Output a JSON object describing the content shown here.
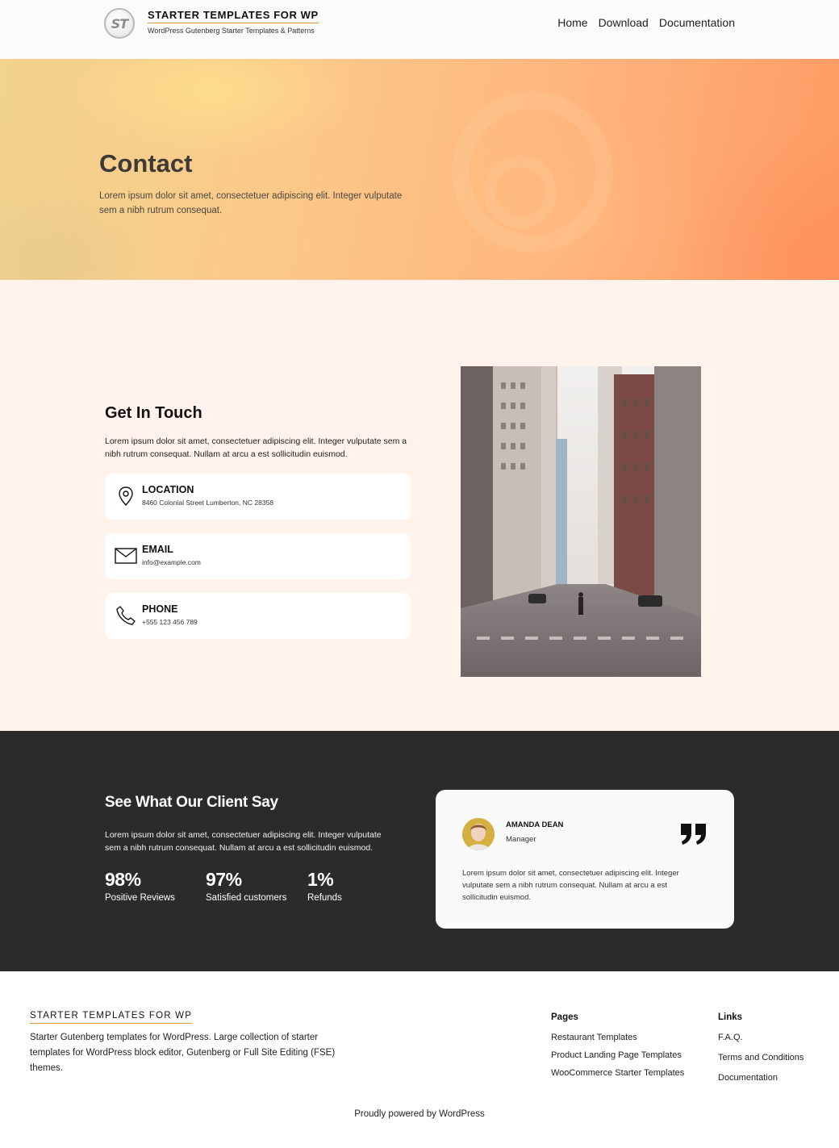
{
  "header": {
    "logo_text": "ST",
    "site_title": "STARTER TEMPLATES FOR WP",
    "tagline": "WordPress Gutenberg Starter Templates & Patterns",
    "nav": [
      "Home",
      "Download",
      "Documentation"
    ]
  },
  "hero": {
    "title": "Contact",
    "text": "Lorem ipsum dolor sit amet, consectetuer adipiscing elit. Integer vulputate sem a nibh rutrum consequat."
  },
  "contact": {
    "heading": "Get In Touch",
    "intro": "Lorem ipsum dolor sit amet, consectetuer adipiscing elit. Integer vulputate sem a nibh rutrum consequat. Nullam at arcu a est sollicitudin euismod.",
    "cards": [
      {
        "label": "LOCATION",
        "value": "8460 Colonial Street Lumberton, NC 28358",
        "icon": "location-pin-icon"
      },
      {
        "label": "EMAIL",
        "value": "info@example.com",
        "icon": "envelope-icon"
      },
      {
        "label": "PHONE",
        "value": "+555 123 456 789",
        "icon": "phone-icon"
      }
    ]
  },
  "testimonials": {
    "heading": "See What Our Client Say",
    "intro": "Lorem ipsum dolor sit amet, consectetuer adipiscing elit. Integer vulputate sem a nibh rutrum consequat. Nullam at arcu a est sollicitudin euismod.",
    "stats": [
      {
        "value": "98%",
        "caption": "Positive Reviews"
      },
      {
        "value": "97%",
        "caption": "Satisfied customers"
      },
      {
        "value": "1%",
        "caption": "Refunds"
      }
    ],
    "review": {
      "name": "AMANDA DEAN",
      "role": "Manager",
      "text": "Lorem ipsum dolor sit amet, consectetuer adipiscing elit. Integer vulputate sem a nibh rutrum consequat. Nullam at arcu a est sollicitudin euismod."
    }
  },
  "footer": {
    "title": "STARTER TEMPLATES FOR WP",
    "description": "Starter Gutenberg templates for WordPress. Large collection of starter templates for WordPress block editor, Gutenberg or Full Site Editing (FSE) themes.",
    "pages_title": "Pages",
    "pages": [
      "Restaurant Templates",
      "Product Landing Page Templates",
      "WooCommerce Starter Templates"
    ],
    "links_title": "Links",
    "links": [
      "F.A.Q.",
      "Terms and Conditions",
      "Documentation"
    ],
    "powered": "Proudly powered by WordPress"
  },
  "colors": {
    "accent_underline": "#e2933f",
    "contact_bg": "#fff3eb",
    "testimonial_bg": "#2b2b2b"
  }
}
